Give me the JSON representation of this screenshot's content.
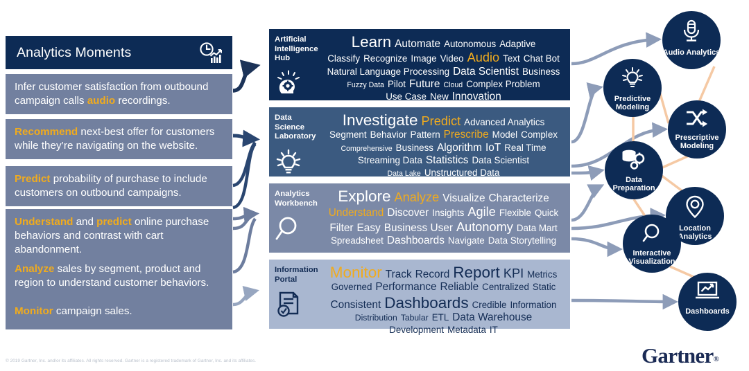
{
  "title": "Analytics Moments",
  "palette": {
    "navy": "#0d2b55",
    "mid_blue": "#3b5a80",
    "slate_blue": "#7b89a7",
    "light_blue": "#a9b7d0",
    "gold": "#f0ab1e",
    "arrow_blue": "#8d9cb8",
    "connector_peach": "#f5c9a4",
    "panel_item": "#72809f"
  },
  "header": {
    "title": "Analytics Moments",
    "icon": "clock-bar-chart-icon"
  },
  "moments": [
    {
      "id": "moment-audio",
      "parts": [
        {
          "t": "Infer customer satisfaction from outbound campaign calls ",
          "hl": false
        },
        {
          "t": "audio",
          "hl": true
        },
        {
          "t": " recordings.",
          "hl": false
        }
      ]
    },
    {
      "id": "moment-recommend",
      "parts": [
        {
          "t": "Recommend",
          "hl": true
        },
        {
          "t": " next-best offer for customers while they’re navigating on the website.",
          "hl": false
        }
      ]
    },
    {
      "id": "moment-predict",
      "parts": [
        {
          "t": "Predict",
          "hl": true
        },
        {
          "t": " probability of purchase to include customers on outbound campaigns.",
          "hl": false
        }
      ]
    },
    {
      "id": "moment-understand",
      "parts": [
        {
          "t": "Understand",
          "hl": true
        },
        {
          "t": " and ",
          "hl": false
        },
        {
          "t": "predict",
          "hl": true
        },
        {
          "t": " online purchase behaviors and contrast with cart abandonment.",
          "hl": false
        }
      ]
    },
    {
      "id": "moment-analyze",
      "parts": [
        {
          "t": "Analyze",
          "hl": true
        },
        {
          "t": " sales by segment, product and region to understand customer behaviors.",
          "hl": false
        }
      ]
    },
    {
      "id": "moment-monitor",
      "parts": [
        {
          "t": "Monitor",
          "hl": true
        },
        {
          "t": " campaign sales.",
          "hl": false
        }
      ]
    }
  ],
  "capability_boxes": [
    {
      "id": "box-ai",
      "label": "Artificial Intelligence Hub",
      "icon": "head-gear-idea-icon",
      "bg": "#0d2b55",
      "text_color": "#ffffff",
      "cloud": [
        [
          {
            "t": "Learn",
            "s": "s18"
          },
          {
            "t": "Automate",
            "s": "s12"
          },
          {
            "t": "Autonomous",
            "s": "s10"
          },
          {
            "t": "Adaptive",
            "s": "s10"
          }
        ],
        [
          {
            "t": "Classify",
            "s": "s10"
          },
          {
            "t": "Recognize",
            "s": "s10"
          },
          {
            "t": "Image",
            "s": "s10"
          },
          {
            "t": "Video",
            "s": "s10"
          },
          {
            "t": "Audio",
            "s": "s14",
            "hl": true
          },
          {
            "t": "Text",
            "s": "s10"
          },
          {
            "t": "Chat Bot",
            "s": "s10"
          }
        ],
        [
          {
            "t": "Natural Language Processing",
            "s": "s10"
          },
          {
            "t": "Data Scientist",
            "s": "s12"
          },
          {
            "t": "Business",
            "s": "s10"
          }
        ],
        [
          {
            "t": "Fuzzy Data",
            "s": "s8"
          },
          {
            "t": "Pilot",
            "s": "s10"
          },
          {
            "t": "Future",
            "s": "s12"
          },
          {
            "t": "Cloud",
            "s": "s8"
          },
          {
            "t": "Complex Problem",
            "s": "s10"
          }
        ],
        [
          {
            "t": "Use Case",
            "s": "s10"
          },
          {
            "t": "New",
            "s": "s10"
          },
          {
            "t": "Innovation",
            "s": "s12"
          }
        ]
      ]
    },
    {
      "id": "box-dsl",
      "label": "Data Science Laboratory",
      "icon": "lightbulb-idea-icon",
      "bg": "#3b5a80",
      "text_color": "#ffffff",
      "cloud": [
        [
          {
            "t": "Investigate",
            "s": "s18"
          },
          {
            "t": "Predict",
            "s": "s14",
            "hl": true
          },
          {
            "t": "Advanced Analytics",
            "s": "s10"
          }
        ],
        [
          {
            "t": "Segment",
            "s": "s10"
          },
          {
            "t": "Behavior",
            "s": "s10"
          },
          {
            "t": "Pattern",
            "s": "s10"
          },
          {
            "t": "Prescribe",
            "s": "s12",
            "hl": true
          },
          {
            "t": "Model",
            "s": "s10"
          },
          {
            "t": "Complex",
            "s": "s10"
          }
        ],
        [
          {
            "t": "Comprehensive",
            "s": "s8"
          },
          {
            "t": "Business",
            "s": "s10"
          },
          {
            "t": "Algorithm",
            "s": "s12"
          },
          {
            "t": "IoT",
            "s": "s12"
          },
          {
            "t": "Real Time",
            "s": "s10"
          }
        ],
        [
          {
            "t": "Streaming Data",
            "s": "s10"
          },
          {
            "t": "Statistics",
            "s": "s12"
          },
          {
            "t": "Data Scientist",
            "s": "s10"
          }
        ],
        [
          {
            "t": "Data Lake",
            "s": "s8"
          },
          {
            "t": "Unstructured Data",
            "s": "s10"
          }
        ]
      ]
    },
    {
      "id": "box-awb",
      "label": "Analytics Workbench",
      "icon": "magnifier-icon",
      "bg": "#7b89a7",
      "text_color": "#ffffff",
      "cloud": [
        [
          {
            "t": "Explore",
            "s": "s18"
          },
          {
            "t": "Analyze",
            "s": "s14",
            "hl": true
          },
          {
            "t": "Visualize",
            "s": "s12"
          },
          {
            "t": "Characterize",
            "s": "s12"
          }
        ],
        [
          {
            "t": "Understand",
            "s": "s12",
            "hl": true
          },
          {
            "t": "Discover",
            "s": "s12"
          },
          {
            "t": "Insights",
            "s": "s10"
          },
          {
            "t": "Agile",
            "s": "s14"
          },
          {
            "t": "Flexible",
            "s": "s10"
          },
          {
            "t": "Quick",
            "s": "s10"
          }
        ],
        [
          {
            "t": "Filter",
            "s": "s12"
          },
          {
            "t": "Easy",
            "s": "s12"
          },
          {
            "t": "Business User",
            "s": "s12"
          },
          {
            "t": "Autonomy",
            "s": "s14"
          },
          {
            "t": "Data Mart",
            "s": "s10"
          }
        ],
        [
          {
            "t": "Spreadsheet",
            "s": "s10"
          },
          {
            "t": "Dashboards",
            "s": "s12"
          },
          {
            "t": "Navigate",
            "s": "s10"
          },
          {
            "t": "Data Storytelling",
            "s": "s10"
          }
        ]
      ]
    },
    {
      "id": "box-ip",
      "label": "Information Portal",
      "icon": "document-check-icon",
      "bg": "#a9b7d0",
      "text_color": "#132c54",
      "cloud": [
        [
          {
            "t": "Monitor",
            "s": "s18",
            "hl": true
          },
          {
            "t": "Track",
            "s": "s12"
          },
          {
            "t": "Record",
            "s": "s12"
          },
          {
            "t": "Report",
            "s": "s18"
          },
          {
            "t": "KPI",
            "s": "s14"
          },
          {
            "t": "Metrics",
            "s": "s10"
          }
        ],
        [
          {
            "t": "Governed",
            "s": "s10"
          },
          {
            "t": "Performance",
            "s": "s12"
          },
          {
            "t": "Reliable",
            "s": "s12"
          },
          {
            "t": "Centralized",
            "s": "s10"
          },
          {
            "t": "Static",
            "s": "s10"
          }
        ],
        [
          {
            "t": "Consistent",
            "s": "s12"
          },
          {
            "t": "Dashboards",
            "s": "s18"
          },
          {
            "t": "Credible",
            "s": "s10"
          },
          {
            "t": "Information",
            "s": "s10"
          }
        ],
        [
          {
            "t": "Distribution",
            "s": "s9"
          },
          {
            "t": "Tabular",
            "s": "s9"
          },
          {
            "t": "ETL",
            "s": "s10"
          },
          {
            "t": "Data Warehouse",
            "s": "s12"
          }
        ],
        [
          {
            "t": "Development",
            "s": "s10"
          },
          {
            "t": "Metadata",
            "s": "s10"
          },
          {
            "t": "IT",
            "s": "s10"
          }
        ]
      ]
    }
  ],
  "capabilities": [
    {
      "id": "c-audio",
      "label": "Audio Analytics",
      "icon": "microphone-icon"
    },
    {
      "id": "c-pred",
      "label": "Predictive Modeling",
      "icon": "lightbulb-idea-icon"
    },
    {
      "id": "c-presc",
      "label": "Prescriptive Modeling",
      "icon": "shuffle-arrows-icon"
    },
    {
      "id": "c-prep",
      "label": "Data Preparation",
      "icon": "database-gears-icon"
    },
    {
      "id": "c-loc",
      "label": "Location Analytics",
      "icon": "map-pin-icon"
    },
    {
      "id": "c-ivis",
      "label": "Interactive Visualization",
      "icon": "magnifier-icon"
    },
    {
      "id": "c-dash",
      "label": "Dashboards",
      "icon": "laptop-chart-icon"
    }
  ],
  "footer": {
    "copyright": "© 2019 Gartner, Inc. and/or its affiliates. All rights reserved. Gartner is a registered trademark of Gartner, Inc. and its affiliates.",
    "logo_text": "Gartner",
    "logo_mark": "®"
  }
}
